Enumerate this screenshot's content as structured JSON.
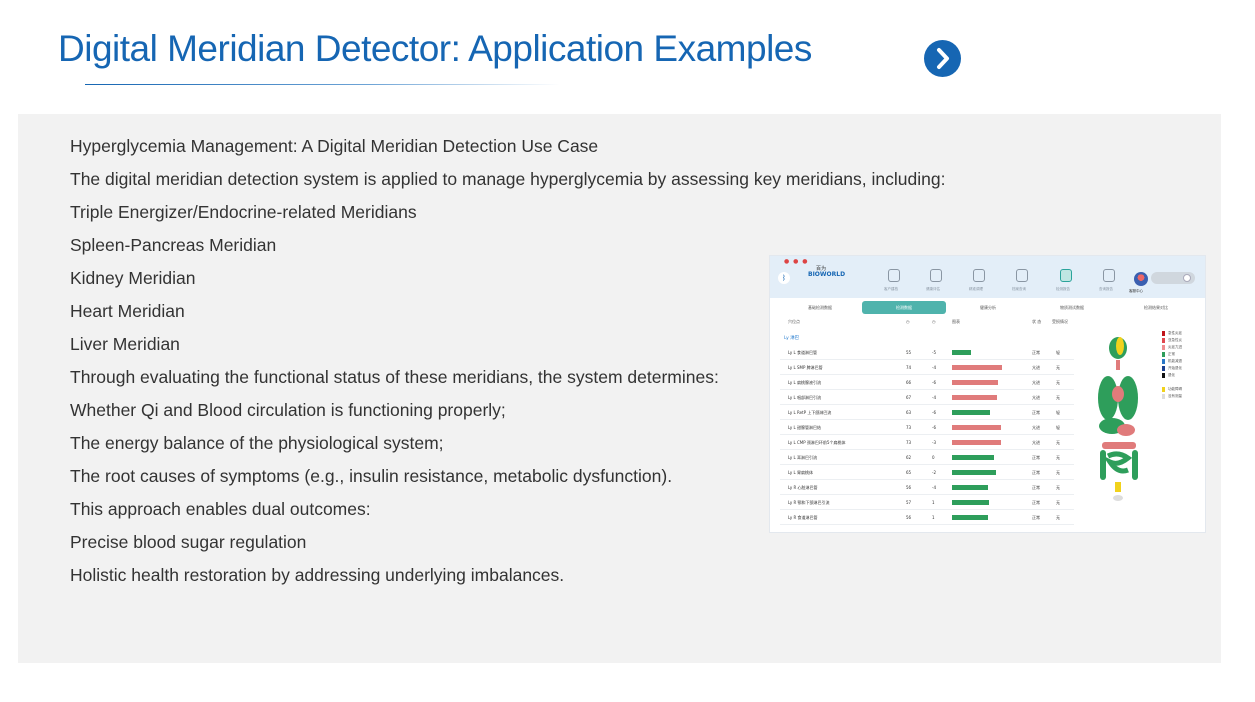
{
  "title": "Digital Meridian Detector: Application Examples",
  "title_icon": "chevron-right-circle-icon",
  "accent_color": "#1666b3",
  "panel_color": "#f2f2f2",
  "lines": [
    "Hyperglycemia Management: A Digital Meridian Detection Use Case",
    "The digital meridian detection system is applied to manage hyperglycemia by assessing key meridians, including:",
    "Triple Energizer/Endocrine-related Meridians",
    "Spleen-Pancreas Meridian",
    "Kidney Meridian",
    "Heart Meridian",
    "Liver Meridian",
    "Through evaluating the functional status of these meridians, the system determines:",
    "Whether Qi and Blood circulation is functioning properly;",
    "The energy balance of the physiological system;",
    "The root causes of symptoms (e.g., insulin resistance, metabolic dysfunction).",
    "This approach enables dual outcomes:",
    "Precise blood sugar regulation",
    "Holistic health restoration by addressing underlying imbalances."
  ],
  "screenshot": {
    "brand": "BIOWORLD",
    "brand_cn": "百为",
    "bluetooth_icon": "bluetooth-icon",
    "nav": [
      {
        "label": "客户建档",
        "icon": "add-client-icon",
        "active": false
      },
      {
        "label": "健康评估",
        "icon": "shield-icon",
        "active": false
      },
      {
        "label": "精准调理",
        "icon": "target-icon",
        "active": false
      },
      {
        "label": "档案查询",
        "icon": "file-icon",
        "active": false
      },
      {
        "label": "检测报告",
        "icon": "report-icon",
        "active": true
      },
      {
        "label": "查询报告",
        "icon": "search-report-icon",
        "active": false
      }
    ],
    "user_name": "客服中心",
    "tabs": [
      {
        "label": "基础检测数据",
        "active": false
      },
      {
        "label": "检测数据",
        "active": true
      },
      {
        "label": "健康分析",
        "active": false
      },
      {
        "label": "物质测试数据",
        "active": false
      },
      {
        "label": "检测结果对比",
        "active": false
      }
    ],
    "headers": [
      "穴位点",
      "◷",
      "◷",
      "图表",
      "状 态",
      "受损情况"
    ],
    "section_label": "Ly 淋巴",
    "rows": [
      {
        "name": "Ly   L  食道淋巴管",
        "v1": "55",
        "v2": "-5",
        "level": 0.36,
        "color": "#2e9e5b",
        "status": "正常",
        "damage": "轻"
      },
      {
        "name": "Ly   L  SMP 脾淋巴管",
        "v1": "74",
        "v2": "-4",
        "level": 0.96,
        "color": "#e07b7b",
        "status": "亢进",
        "damage": "无"
      },
      {
        "name": "Ly   L  扁桃腺液引流",
        "v1": "66",
        "v2": "-6",
        "level": 0.88,
        "color": "#e07b7b",
        "status": "亢进",
        "damage": "无"
      },
      {
        "name": "Ly   L  咽部淋巴引流",
        "v1": "67",
        "v2": "-4",
        "level": 0.86,
        "color": "#e07b7b",
        "status": "亢进",
        "damage": "无"
      },
      {
        "name": "Ly   L  RetP 上下颌淋巴流",
        "v1": "63",
        "v2": "-6",
        "level": 0.74,
        "color": "#2e9e5b",
        "status": "正常",
        "damage": "轻"
      },
      {
        "name": "Ly   L  甜腺管淋巴结",
        "v1": "73",
        "v2": "-6",
        "level": 0.94,
        "color": "#e07b7b",
        "status": "亢进",
        "damage": "轻"
      },
      {
        "name": "Ly   L  CMP 颈淋巴环前5个扁桃体",
        "v1": "73",
        "v2": "-3",
        "level": 0.94,
        "color": "#e07b7b",
        "status": "亢进",
        "damage": "无"
      },
      {
        "name": "Ly   L  耳淋巴引流",
        "v1": "62",
        "v2": "0",
        "level": 0.8,
        "color": "#2e9e5b",
        "status": "正常",
        "damage": "无"
      },
      {
        "name": "Ly   L  胃扁桃体",
        "v1": "65",
        "v2": "-2",
        "level": 0.84,
        "color": "#2e9e5b",
        "status": "正常",
        "damage": "无"
      },
      {
        "name": "Ly   R  心脏淋巴管",
        "v1": "56",
        "v2": "-4",
        "level": 0.7,
        "color": "#2e9e5b",
        "status": "正常",
        "damage": "无"
      },
      {
        "name": "Ly   R  颚和下颌淋巴引流",
        "v1": "57",
        "v2": "1",
        "level": 0.72,
        "color": "#2e9e5b",
        "status": "正常",
        "damage": "无"
      },
      {
        "name": "Ly   R  食道淋巴管",
        "v1": "56",
        "v2": "1",
        "level": 0.7,
        "color": "#2e9e5b",
        "status": "正常",
        "damage": "无"
      }
    ],
    "legend": [
      {
        "label": "急性炎症",
        "color": "#c0151b"
      },
      {
        "label": "亚急性炎",
        "color": "#e0484e"
      },
      {
        "label": "炎症亢进",
        "color": "#ee8d8f"
      },
      {
        "label": "正常",
        "color": "#2e9e5b"
      },
      {
        "label": "机能减退",
        "color": "#2a78c8"
      },
      {
        "label": "开始退化",
        "color": "#1c3f8e"
      },
      {
        "label": "退化",
        "color": "#111111"
      },
      {
        "label": "",
        "color": ""
      },
      {
        "label": "功能障碍",
        "color": "#f1d21c"
      },
      {
        "label": "没有测量",
        "color": "#dddddd"
      }
    ]
  }
}
